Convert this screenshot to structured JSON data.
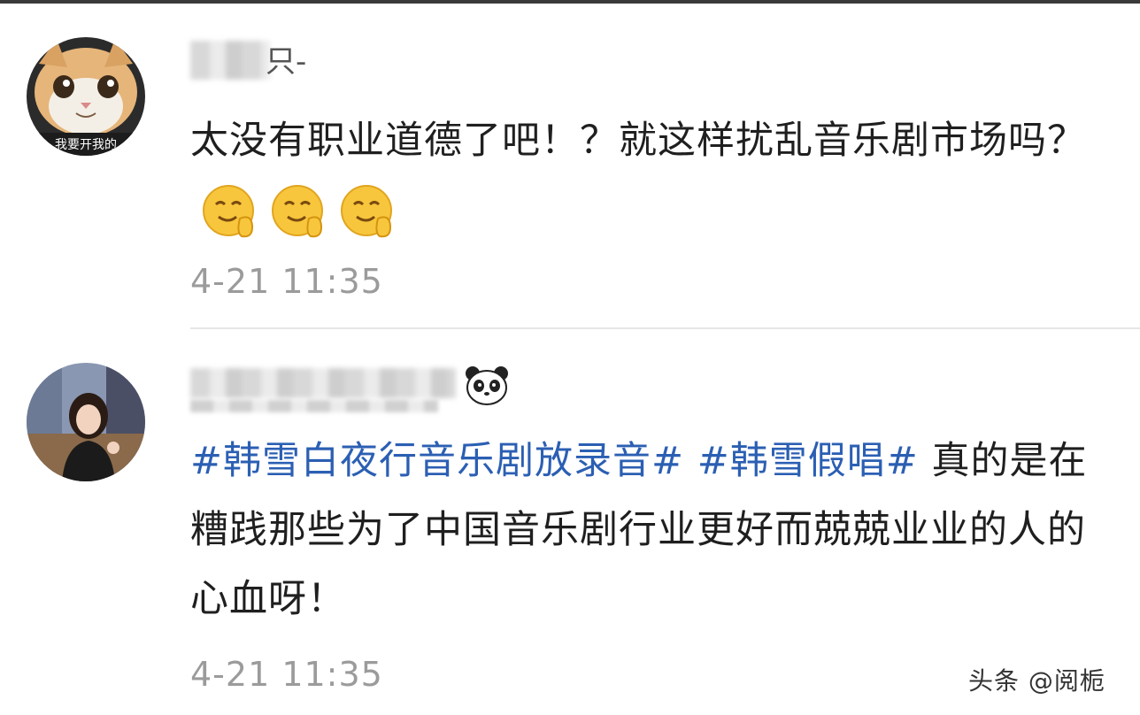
{
  "comments": [
    {
      "username_suffix": "只-",
      "text": "太没有职业道德了吧！？就这样扰乱音乐剧市场吗？",
      "emojis": [
        "smile-pray-emoji",
        "smile-pray-emoji",
        "smile-pray-emoji"
      ],
      "timestamp": "4-21 11:35",
      "avatar": "cat-avatar",
      "avatar_caption": "我要开我的"
    },
    {
      "hashtags": [
        "#韩雪白夜行音乐剧放录音#",
        "#韩雪假唱#"
      ],
      "text": "真的是在糟践那些为了中国音乐剧行业更好而兢兢业业的人的心血呀！",
      "badge": "panda-icon",
      "timestamp": "4-21 11:35",
      "avatar": "woman-avatar"
    }
  ],
  "watermark": "头条 @阅栀",
  "colors": {
    "text": "#1f1f1f",
    "hashtag": "#2b5fb3",
    "timestamp": "#9b9b9b",
    "divider": "#e6e6e6"
  }
}
